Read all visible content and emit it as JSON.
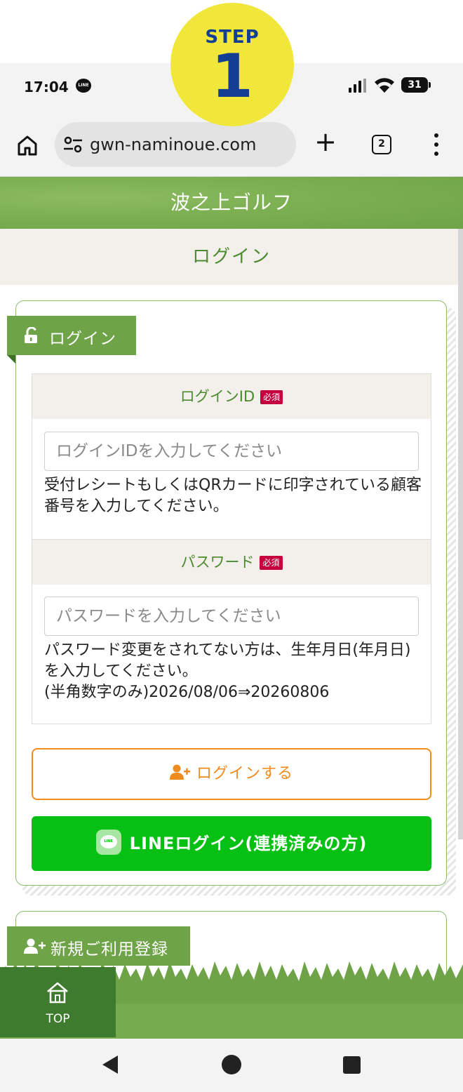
{
  "step_badge": {
    "word": "STEP",
    "number": "1"
  },
  "status_bar": {
    "time": "17:04",
    "notification": "LINE",
    "battery": "31"
  },
  "browser": {
    "url": "gwn-naminoue.com",
    "tab_count": "2"
  },
  "site": {
    "title": "波之上ゴルフ",
    "page_title": "ログイン"
  },
  "login_card": {
    "tab_label": "ログイン",
    "required_badge": "必須",
    "login_id": {
      "label": "ログインID",
      "placeholder": "ログインIDを入力してください",
      "help": "受付レシートもしくはQRカードに印字されている顧客番号を入力してください。"
    },
    "password": {
      "label": "パスワード",
      "placeholder": "パスワードを入力してください",
      "help": "パスワード変更をされてない方は、生年月日(年月日)を入力してください。",
      "example": "(半角数字のみ)2026/08/06⇒20260806"
    },
    "login_button": "ログインする",
    "line_button": "LINEログイン(連携済みの方)",
    "line_logo_text": "LINE"
  },
  "register_card": {
    "tab_label": "新規ご利用登録"
  },
  "footer_nav": {
    "top_label": "TOP"
  },
  "colors": {
    "brand_green": "#6ea347",
    "text_green": "#4b8a2e",
    "required_red": "#c4003f",
    "login_orange": "#f08c1e",
    "line_green": "#06c113",
    "step_yellow": "#f1e63a",
    "step_blue": "#123e94"
  },
  "icons": [
    "home-icon",
    "tune-icon",
    "plus-icon",
    "tabs-icon",
    "more-icon",
    "unlock-icon",
    "user-plus-icon",
    "line-logo-icon",
    "back-icon",
    "circle-home-icon",
    "recents-icon"
  ]
}
